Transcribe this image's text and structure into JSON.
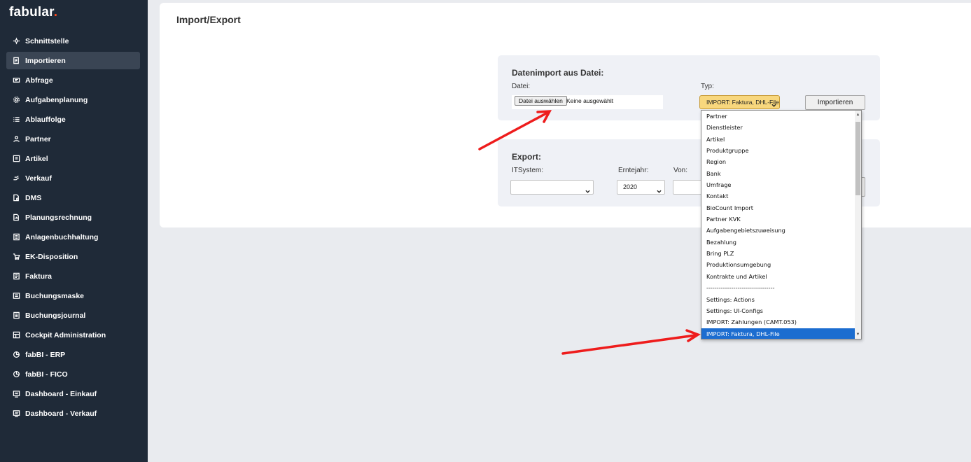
{
  "app": {
    "logo_text": "fabular",
    "logo_dot": ".",
    "accent_color": "#ff4a1a"
  },
  "sidebar": {
    "items": [
      {
        "label": "Schnittstelle",
        "icon": "interface-icon"
      },
      {
        "label": "Importieren",
        "icon": "import-icon",
        "active": true
      },
      {
        "label": "Abfrage",
        "icon": "query-icon"
      },
      {
        "label": "Aufgabenplanung",
        "icon": "gear-icon"
      },
      {
        "label": "Ablauffolge",
        "icon": "list-icon"
      },
      {
        "label": "Partner",
        "icon": "user-icon"
      },
      {
        "label": "Artikel",
        "icon": "article-icon"
      },
      {
        "label": "Verkauf",
        "icon": "hand-money-icon"
      },
      {
        "label": "DMS",
        "icon": "document-search-icon"
      },
      {
        "label": "Planungsrechnung",
        "icon": "document-chart-icon"
      },
      {
        "label": "Anlagenbuchhaltung",
        "icon": "ledger-icon"
      },
      {
        "label": "EK-Disposition",
        "icon": "cart-icon"
      },
      {
        "label": "Faktura",
        "icon": "invoice-icon"
      },
      {
        "label": "Buchungsmaske",
        "icon": "form-icon"
      },
      {
        "label": "Buchungsjournal",
        "icon": "journal-icon"
      },
      {
        "label": "Cockpit Administration",
        "icon": "cockpit-icon"
      },
      {
        "label": "fabBI - ERP",
        "icon": "bi-icon"
      },
      {
        "label": "fabBI - FICO",
        "icon": "bi-icon"
      },
      {
        "label": "Dashboard - Einkauf",
        "icon": "dashboard-icon"
      },
      {
        "label": "Dashboard - Verkauf",
        "icon": "dashboard-icon"
      }
    ]
  },
  "main": {
    "title": "Import/Export",
    "import": {
      "heading": "Datenimport aus Datei:",
      "file_label": "Datei:",
      "file_button": "Datei auswählen",
      "file_status": "Keine ausgewählt",
      "type_label": "Typ:",
      "type_selected": "IMPORT: Faktura, DHL-File",
      "type_color": "#f8d77d",
      "import_button": "Importieren"
    },
    "export": {
      "heading": "Export:",
      "itsystem_label": "ITSystem:",
      "itsystem_value": "",
      "year_label": "Erntejahr:",
      "year_value": "2020",
      "from_label": "Von:",
      "from_value": ""
    },
    "type_options": [
      "Partner",
      "Dienstleister",
      "Artikel",
      "Produktgruppe",
      "Region",
      "Bank",
      "Umfrage",
      "Kontakt",
      "BioCount Import",
      "Partner KVK",
      "Aufgabengebietszuweisung",
      "Bezahlung",
      "Bring PLZ",
      "Produktionsumgebung",
      "Kontrakte und Artikel",
      "---------------------------------",
      "Settings: Actions",
      "Settings: UI-Configs",
      "IMPORT: Zahlungen (CAMT.053)",
      "IMPORT: Faktura, DHL-File"
    ],
    "selected_option_index": 19,
    "selection_color": "#1c6dd0"
  },
  "annotations": {
    "arrow_color": "#ee1c1c"
  }
}
